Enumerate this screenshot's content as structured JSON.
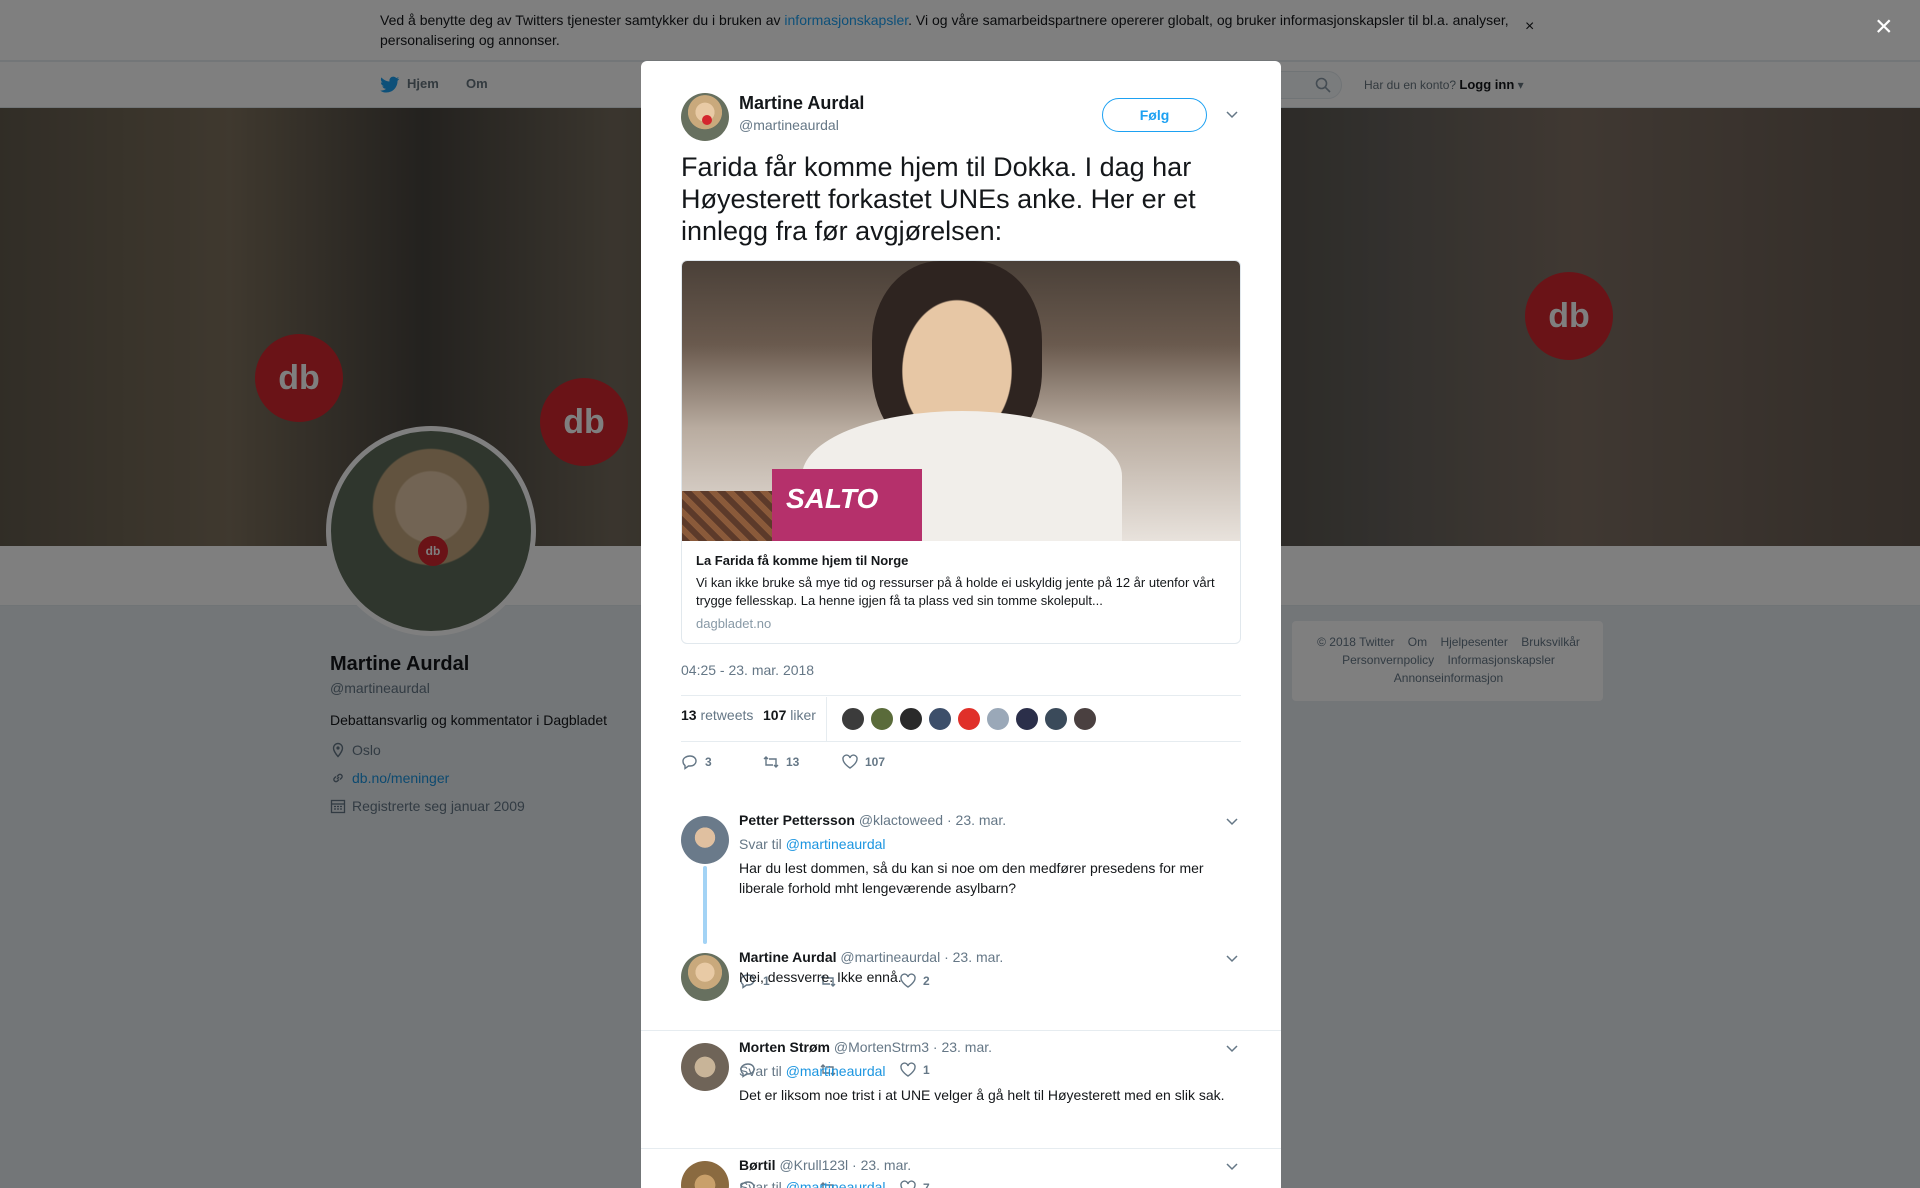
{
  "cookie_bar": {
    "text_before": "Ved å benytte deg av Twitters tjenester samtykker du i bruken av ",
    "link": "informasjonskapsler",
    "text_after": ". Vi og våre samarbeidspartnere opererer globalt, og bruker informasjonskapsler til bl.a. analyser, personalisering og annonser.",
    "close": "×"
  },
  "nav": {
    "home": "Hjem",
    "about": "Om",
    "account_prompt": "Har du en konto?",
    "login": "Logg inn"
  },
  "banner": {
    "mic_label": "db"
  },
  "profile": {
    "name": "Martine Aurdal",
    "handle": "@martineaurdal",
    "bio": "Debattansvarlig og kommentator i Dagbladet",
    "location": "Oslo",
    "website": "db.no/meninger",
    "joined": "Registrerte seg januar 2009"
  },
  "footer": {
    "line1": [
      "© 2018 Twitter",
      "Om",
      "Hjelpesenter",
      "Bruksvilkår"
    ],
    "line2": [
      "Personvernpolicy",
      "Informasjonskapsler"
    ],
    "line3": [
      "Annonseinformasjon"
    ]
  },
  "modal": {
    "close": "×",
    "author_name": "Martine Aurdal",
    "author_handle": "@martineaurdal",
    "follow": "Følg",
    "text": "Farida får komme hjem til Dokka. I dag har Høyesterett forkastet UNEs anke. Her er et innlegg fra før avgjørelsen:",
    "card": {
      "image_text": "SALTO",
      "title": "La Farida få komme hjem til Norge",
      "description": "Vi kan ikke bruke så mye tid og ressurser på å holde ei uskyldig jente på 12 år utenfor vårt trygge fellesskap. La henne igjen få ta plass ved sin tomme skolepult...",
      "domain": "dagbladet.no"
    },
    "timestamp": "04:25 - 23. mar. 2018",
    "retweets_count": "13",
    "retweets_label": "retweets",
    "likes_count": "107",
    "likes_label": "liker",
    "liker_colors": [
      "#3b3b3b",
      "#5a6b3a",
      "#2a2a2a",
      "#3d4f6a",
      "#e0302a",
      "#9aa8b8",
      "#2b2f4a",
      "#3a4a5a",
      "#4a4040"
    ],
    "actions": {
      "replies": "3",
      "retweets": "13",
      "likes": "107"
    }
  },
  "replies": [
    {
      "name": "Petter Pettersson",
      "handle": "@klactoweed",
      "date": "· 23. mar.",
      "reply_to_label": "Svar til",
      "reply_to": "@martineaurdal",
      "text": "Har du lest dommen, så du kan si noe om den medfører presedens for mer liberale forhold mht lengeværende asylbarn?",
      "replies": "1",
      "retweets": "",
      "likes": "2"
    },
    {
      "name": "Martine Aurdal",
      "handle": "@martineaurdal",
      "date": "· 23. mar.",
      "text": "Nei, dessverre. Ikke ennå.",
      "replies": "",
      "retweets": "",
      "likes": "1"
    },
    {
      "name": "Morten Strøm",
      "handle": "@MortenStrm3",
      "date": "· 23. mar.",
      "reply_to_label": "Svar til",
      "reply_to": "@martineaurdal",
      "text": "Det er liksom noe trist i at UNE velger å gå helt til Høyesterett med en slik sak.",
      "replies": "",
      "retweets": "",
      "likes": "7"
    },
    {
      "name": "Børtil",
      "handle": "@Krull123l",
      "date": "· 23. mar.",
      "reply_to_label": "Svar til",
      "reply_to": "@martineaurdal"
    }
  ]
}
